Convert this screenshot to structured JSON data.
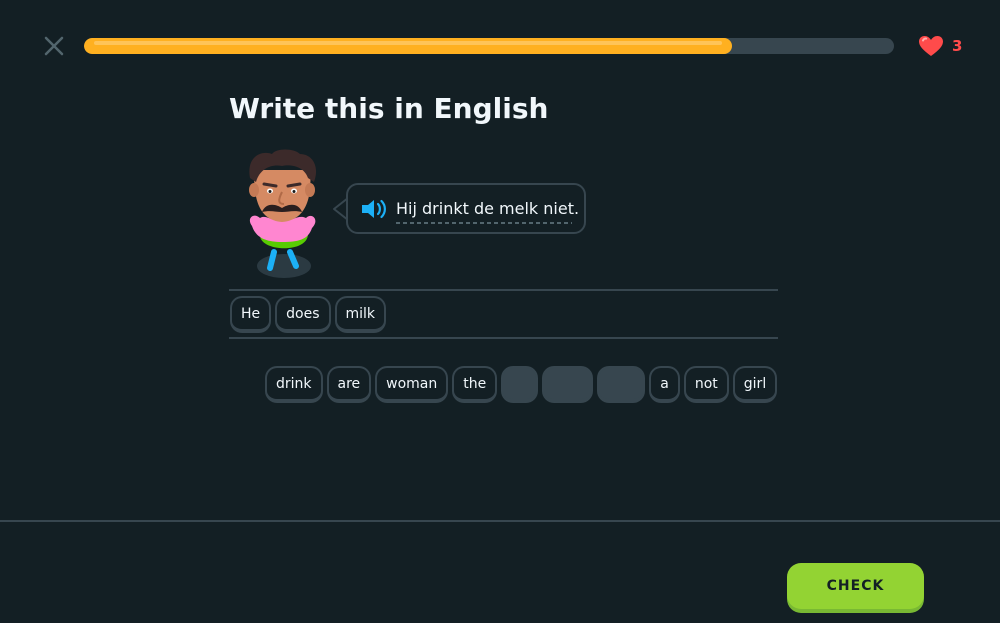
{
  "header": {
    "close_icon": "close-icon",
    "progress_percent": 80,
    "progress_color": "#ffb020",
    "hearts": {
      "count": "3",
      "icon": "heart-icon",
      "color": "#ff4b4b"
    }
  },
  "challenge": {
    "title": "Write this in English",
    "character_icon": "mustache-man-character",
    "speech": {
      "speaker_icon": "speaker-icon",
      "text": "Hij drinkt de melk niet."
    }
  },
  "answer": {
    "tiles": [
      "He",
      "does",
      "milk"
    ]
  },
  "word_bank": {
    "tiles": [
      {
        "label": "drink",
        "used": false
      },
      {
        "label": "are",
        "used": false
      },
      {
        "label": "woman",
        "used": false
      },
      {
        "label": "the",
        "used": false
      },
      {
        "label": "",
        "used": true
      },
      {
        "label": "",
        "used": true
      },
      {
        "label": "",
        "used": true
      },
      {
        "label": "a",
        "used": false
      },
      {
        "label": "not",
        "used": false
      },
      {
        "label": "girl",
        "used": false
      }
    ]
  },
  "footer": {
    "check_label": "CHECK",
    "check_color": "#93d333"
  }
}
